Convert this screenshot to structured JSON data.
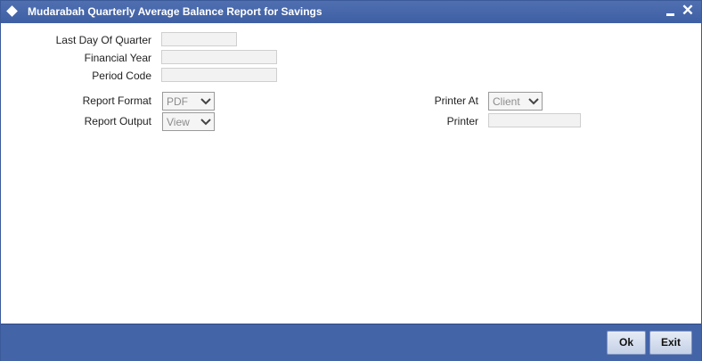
{
  "window": {
    "title": "Mudarabah Quarterly Average Balance Report for Savings",
    "accent": "#4464a8"
  },
  "form": {
    "last_day_label": "Last Day Of Quarter",
    "last_day_value": "",
    "financial_year_label": "Financial Year",
    "financial_year_value": "",
    "period_code_label": "Period Code",
    "period_code_value": "",
    "report_format_label": "Report Format",
    "report_format_value": "PDF",
    "report_output_label": "Report Output",
    "report_output_value": "View",
    "printer_at_label": "Printer At",
    "printer_at_value": "Client",
    "printer_label": "Printer",
    "printer_value": ""
  },
  "footer": {
    "ok_label": "Ok",
    "exit_label": "Exit"
  }
}
